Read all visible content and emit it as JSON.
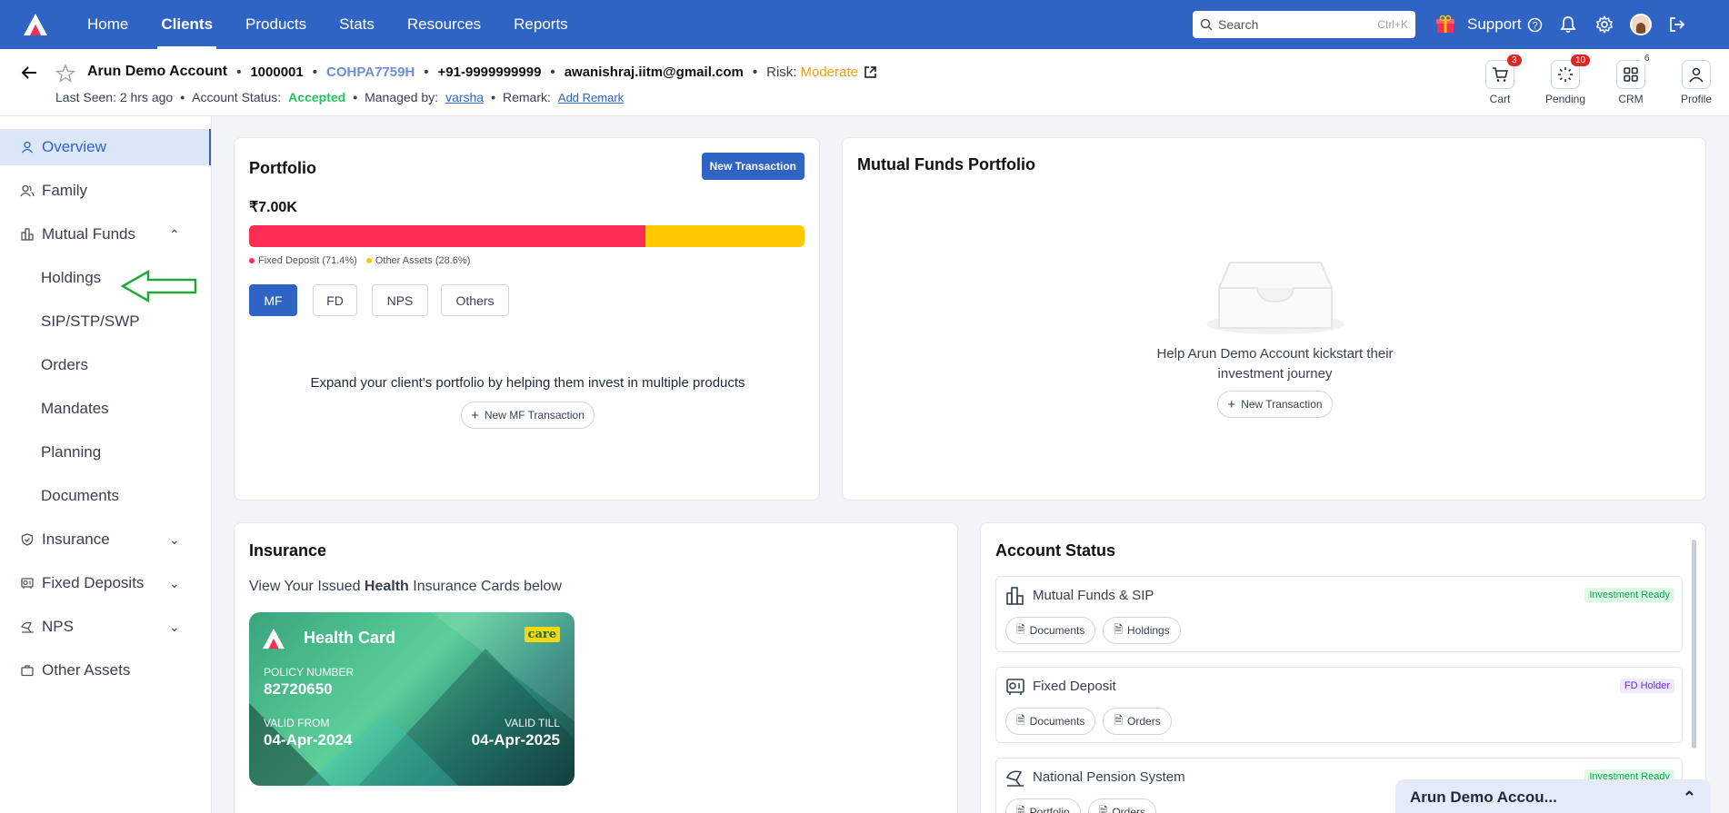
{
  "nav": {
    "items": [
      "Home",
      "Clients",
      "Products",
      "Stats",
      "Resources",
      "Reports"
    ],
    "active": "Clients",
    "search_placeholder": "Search",
    "search_shortcut": "Ctrl+K",
    "support_label": "Support"
  },
  "client": {
    "name": "Arun Demo Account",
    "id": "1000001",
    "pan": "COHPA7759H",
    "phone": "+91-9999999999",
    "email": "awanishraj.iitm@gmail.com",
    "risk_label": "Risk:",
    "risk_value": "Moderate",
    "last_seen": "Last Seen: 2 hrs ago",
    "status_label": "Account Status:",
    "status_value": "Accepted",
    "managed_label": "Managed by:",
    "managed_by": "varsha",
    "remark_label": "Remark:",
    "add_remark": "Add Remark"
  },
  "header_actions": [
    {
      "label": "Cart",
      "badge": "3"
    },
    {
      "label": "Pending",
      "badge": "10"
    },
    {
      "label": "CRM",
      "badge": "6"
    },
    {
      "label": "Profile",
      "badge": ""
    }
  ],
  "sidebar": {
    "overview": "Overview",
    "family": "Family",
    "mutual_funds": "Mutual Funds",
    "mf_sub": [
      "Holdings",
      "SIP/STP/SWP",
      "Orders",
      "Mandates",
      "Planning",
      "Documents"
    ],
    "insurance": "Insurance",
    "fixed_deposits": "Fixed Deposits",
    "nps": "NPS",
    "other_assets": "Other Assets"
  },
  "portfolio": {
    "title": "Portfolio",
    "new_txn": "New Transaction",
    "total": "₹7.00K",
    "fd_fraction": 0.714,
    "legend_fd": "Fixed Deposit (71.4%)",
    "legend_other": "Other Assets (28.6%)",
    "colors": {
      "fd": "#fb2d55",
      "other": "#ffc800"
    },
    "tabs": [
      "MF",
      "FD",
      "NPS",
      "Others"
    ],
    "message": "Expand your client's portfolio by helping them invest in multiple products",
    "new_mf_txn": "New MF Transaction"
  },
  "mf_portfolio": {
    "title": "Mutual Funds Portfolio",
    "empty_line1": "Help Arun Demo Account kickstart their",
    "empty_line2": "investment journey",
    "new_txn": "New Transaction"
  },
  "insurance": {
    "title": "Insurance",
    "sub_pre": "View Your Issued ",
    "sub_bold": "Health",
    "sub_post": " Insurance Cards below",
    "card": {
      "title": "Health Card",
      "insurer_logo": "care",
      "policy_label": "POLICY NUMBER",
      "policy_number": "82720650",
      "valid_from_label": "VALID FROM",
      "valid_from": "04-Apr-2024",
      "valid_till_label": "VALID TILL",
      "valid_till": "04-Apr-2025"
    }
  },
  "account_status": {
    "title": "Account Status",
    "rows": [
      {
        "title": "Mutual Funds & SIP",
        "tag": "Investment Ready",
        "buttons": [
          "Documents",
          "Holdings"
        ]
      },
      {
        "title": "Fixed Deposit",
        "tag": "FD Holder",
        "buttons": [
          "Documents",
          "Orders"
        ]
      },
      {
        "title": "National Pension System",
        "tag": "Investment Ready",
        "buttons": [
          "Portfolio",
          "Orders"
        ]
      }
    ]
  },
  "chat": {
    "title": "Arun Demo Accou..."
  }
}
